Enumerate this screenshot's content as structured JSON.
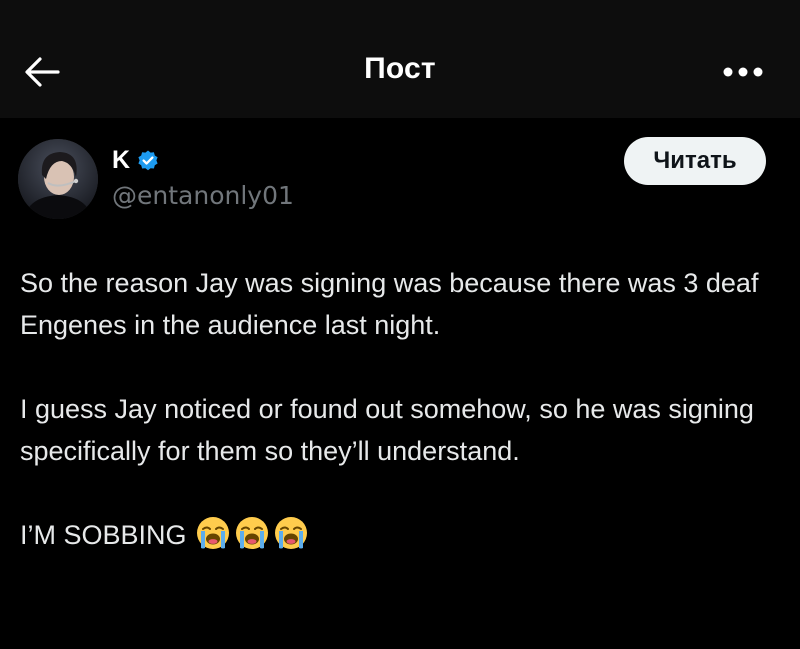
{
  "header": {
    "title": "Пост",
    "back_icon": "arrow-left-icon",
    "more_icon": "more-horizontal-icon"
  },
  "author": {
    "name": "K",
    "handle": "@entanonly01",
    "verified": true,
    "verified_color": "#1d9bf0",
    "avatar_icon": "avatar-photo"
  },
  "follow_button": {
    "label": "Читать"
  },
  "post": {
    "paragraphs": [
      "So the reason Jay was signing was because there was 3 deaf Engenes in the audience last night.",
      "I guess Jay noticed or found out somehow, so he was signing specifically for them so they’ll understand.",
      "I’M SOBBING"
    ],
    "emoji": [
      "😭",
      "😭",
      "😭"
    ]
  },
  "colors": {
    "background": "#000000",
    "header_background": "#0d0d0d",
    "text": "#e7e9ea",
    "muted": "#71767b",
    "button_bg": "#eff3f4",
    "button_text": "#0f1419"
  }
}
